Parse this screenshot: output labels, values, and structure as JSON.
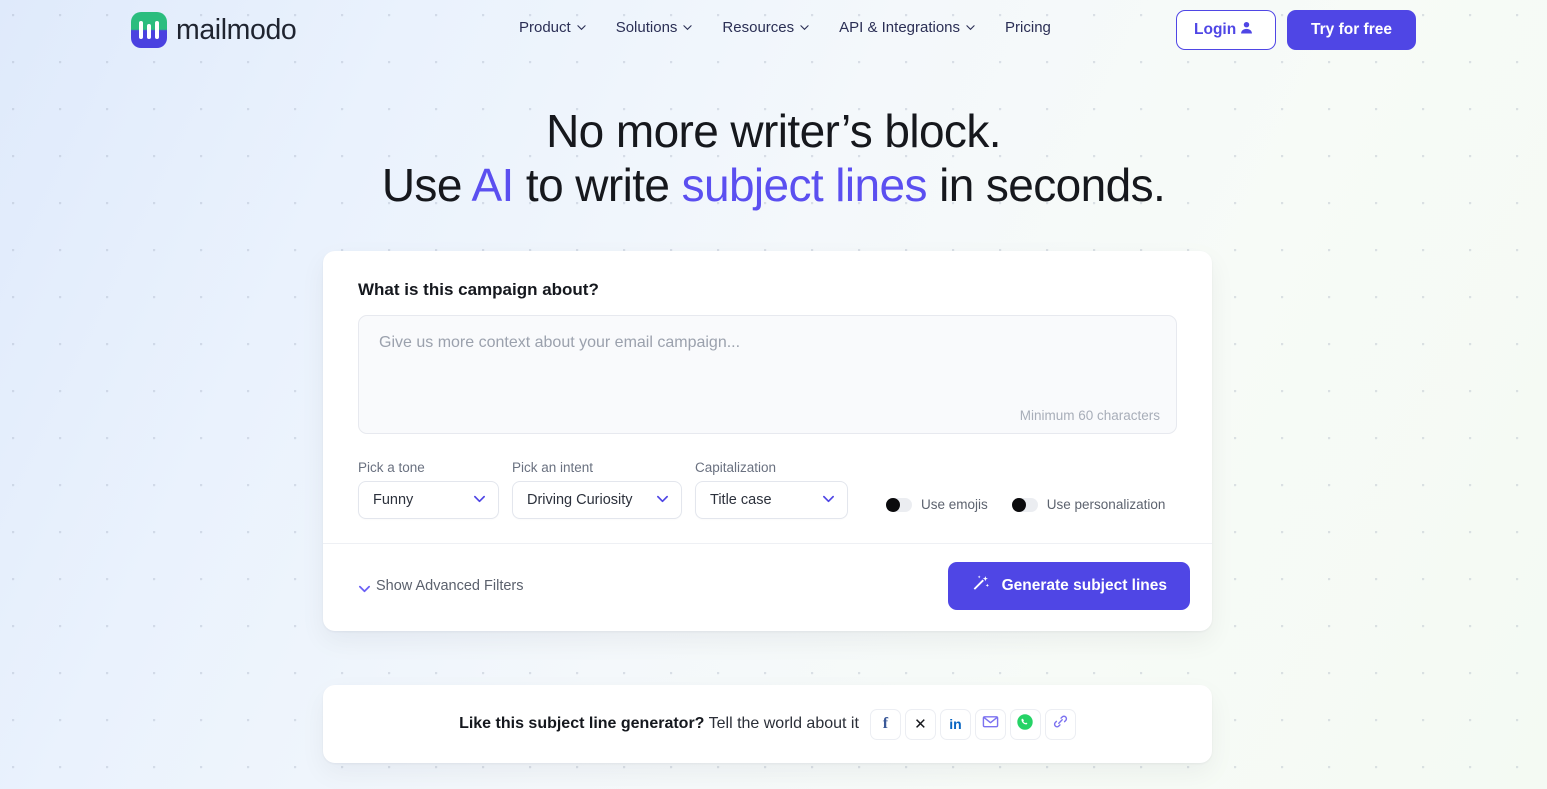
{
  "colors": {
    "accent": "#4f46e5",
    "accent_light": "#5b4ff0",
    "logo_green": "#2bbd7e",
    "logo_blue": "#4a41e0",
    "facebook": "#3b5998",
    "x": "#16181d",
    "linkedin": "#0a66c2",
    "whatsapp": "#25d366",
    "email": "#7c72f0",
    "link": "#7c72f0",
    "page_bg_left": "#dfeafb",
    "page_bg_right": "#f4faf3"
  },
  "header": {
    "brand_name": "mailmodo",
    "logo_icon": "mailmodo-logo-icon",
    "nav": [
      {
        "label": "Product",
        "has_dropdown": true,
        "icon": "chevron-down-icon"
      },
      {
        "label": "Solutions",
        "has_dropdown": true,
        "icon": "chevron-down-icon"
      },
      {
        "label": "Resources",
        "has_dropdown": true,
        "icon": "chevron-down-icon"
      },
      {
        "label": "API & Integrations",
        "has_dropdown": true,
        "icon": "chevron-down-icon"
      },
      {
        "label": "Pricing",
        "has_dropdown": false,
        "icon": ""
      }
    ],
    "login_label": "Login",
    "login_icon": "user-icon",
    "try_label": "Try for free"
  },
  "hero": {
    "line1": "No more writer’s block.",
    "line2_part1": "Use ",
    "line2_accent1": "AI",
    "line2_part2": " to write ",
    "line2_accent2": "subject lines",
    "line2_part3": " in seconds."
  },
  "form": {
    "question": "What is this campaign about?",
    "textarea_value": "",
    "textarea_placeholder": "Give us more context about your email campaign...",
    "char_hint": "Minimum 60 characters",
    "fields": [
      {
        "label": "Pick a tone",
        "value": "Funny",
        "icon": "chevron-down-icon"
      },
      {
        "label": "Pick an intent",
        "value": "Driving Curiosity",
        "icon": "chevron-down-icon"
      },
      {
        "label": "Capitalization",
        "value": "Title case",
        "icon": "chevron-down-icon"
      }
    ],
    "toggles": [
      {
        "label": "Use emojis",
        "state": "off"
      },
      {
        "label": "Use personalization",
        "state": "off"
      }
    ],
    "advanced_label": "Show Advanced Filters",
    "advanced_icon": "chevron-down-icon",
    "generate_label": "Generate subject lines",
    "generate_icon": "magic-wand-icon"
  },
  "share": {
    "text_bold": "Like this subject line generator?",
    "text_rest": " Tell the world about it",
    "buttons": [
      {
        "name": "facebook",
        "glyph": "f"
      },
      {
        "name": "x-twitter",
        "glyph": "✕"
      },
      {
        "name": "linkedin",
        "glyph": "in"
      },
      {
        "name": "email",
        "glyph": "envelope-icon"
      },
      {
        "name": "whatsapp",
        "glyph": "whatsapp-icon"
      },
      {
        "name": "copy-link",
        "glyph": "link-icon"
      }
    ]
  }
}
